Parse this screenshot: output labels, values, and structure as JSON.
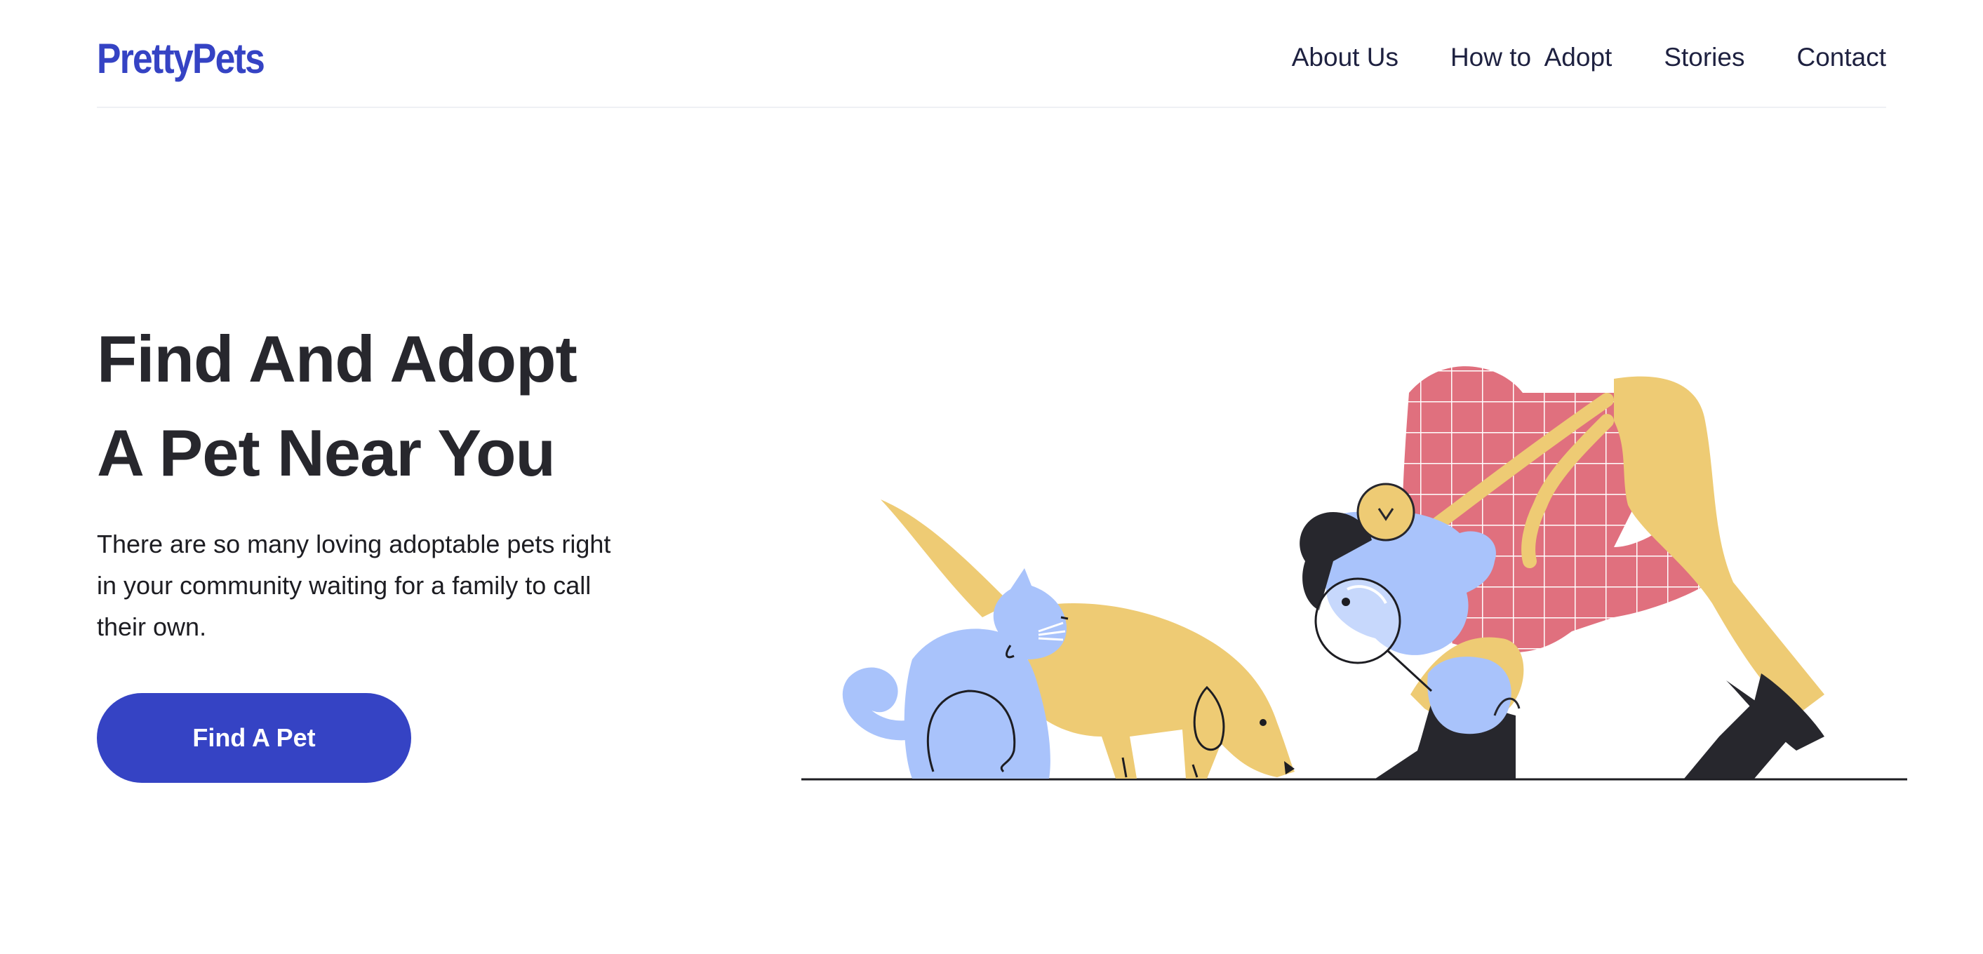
{
  "brand": {
    "logo_text": "PrettyPets",
    "color": "#3543c4"
  },
  "nav": {
    "items": [
      {
        "label": "About Us"
      },
      {
        "label": "How to  Adopt"
      },
      {
        "label": "Stories"
      },
      {
        "label": "Contact"
      }
    ]
  },
  "hero": {
    "title_line1": "Find And Adopt",
    "title_line2": "A Pet Near You",
    "description": "There are so many loving adoptable pets right in your community waiting for a family to call their own.",
    "cta_label": "Find A Pet"
  },
  "illustration": {
    "subjects": [
      "person-with-magnifying-glass",
      "cat",
      "dog"
    ],
    "colors": {
      "yellow": "#eecb74",
      "blue": "#a9c3fb",
      "pink": "#e0707e",
      "dark": "#27272d"
    }
  }
}
